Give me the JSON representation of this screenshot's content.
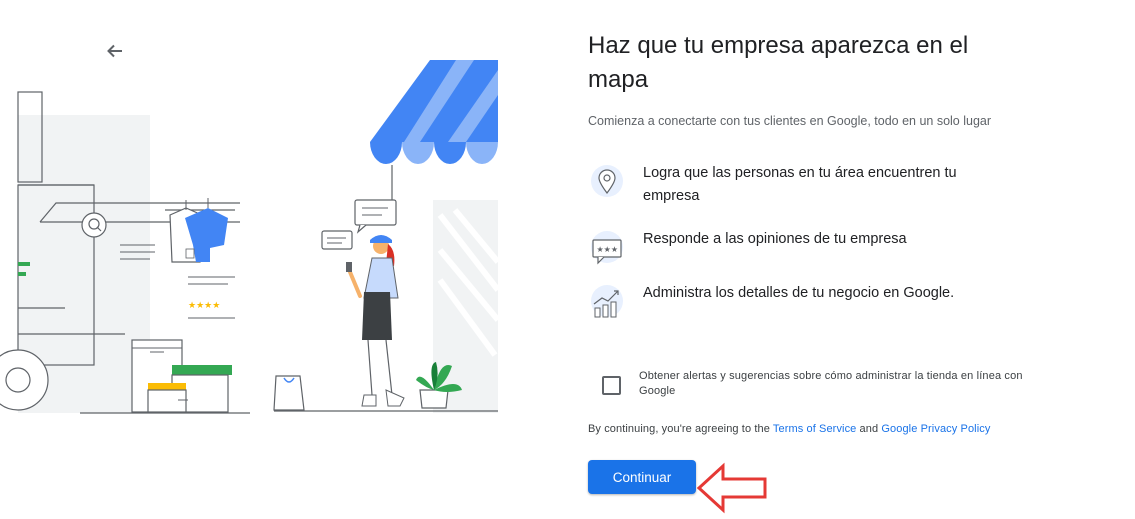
{
  "header": {
    "back_icon": "arrow-back-icon"
  },
  "main": {
    "title": "Haz que tu empresa aparezca en el mapa",
    "subtitle": "Comienza a conectarte con tus clientes en Google, todo en un solo lugar",
    "features": [
      {
        "icon": "map-pin-icon",
        "text": "Logra que las personas en tu área encuentren tu empresa"
      },
      {
        "icon": "review-stars-icon",
        "text": "Responde a las opiniones de tu empresa"
      },
      {
        "icon": "analytics-chart-icon",
        "text": "Administra los detalles de tu negocio en Google."
      }
    ],
    "consent": {
      "checked": false,
      "label": "Obtener alertas y sugerencias sobre cómo administrar la tienda en línea con Google"
    },
    "terms": {
      "prefix": "By continuing, you're agreeing to the ",
      "tos_link": "Terms of Service",
      "and": " and ",
      "privacy_link": "Google Privacy Policy"
    },
    "continue_label": "Continuar"
  },
  "colors": {
    "accent": "#1a73e8",
    "awning_dark": "#4285f4",
    "awning_light": "#8ab4f8",
    "annotation": "#e53935"
  }
}
